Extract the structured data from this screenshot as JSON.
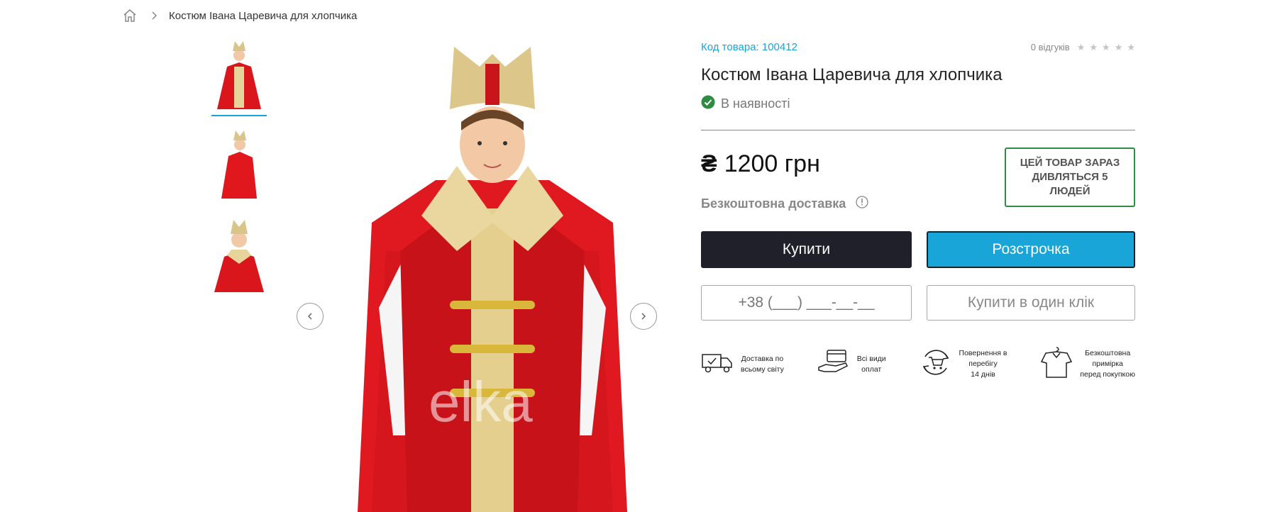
{
  "breadcrumb": {
    "home_icon": "home-icon",
    "current": "Костюм Івана Царевича для хлопчика"
  },
  "gallery": {
    "thumbnails": [
      "thumbnail-front",
      "thumbnail-side",
      "thumbnail-closeup"
    ],
    "watermark": "elka",
    "prev_icon": "chevron-left-icon",
    "next_icon": "chevron-right-icon"
  },
  "product": {
    "code_label": "Код товара: 100412",
    "reviews": "0 відгуків",
    "rating": 0,
    "rating_max": 5,
    "title": "Костюм Івана Царевича для хлопчика",
    "stock": "В наявності",
    "price": "1200 грн",
    "currency_symbol": "₴",
    "delivery": "Безкоштовна доставка",
    "viewers": "ЦЕЙ ТОВАР ЗАРАЗ ДИВЛЯТЬСЯ 5 ЛЮДЕЙ"
  },
  "actions": {
    "buy": "Купити",
    "credit": "Розстрочка",
    "phone_placeholder": "+38 (___) ___-__-__",
    "one_click": "Купити в один клік"
  },
  "features": [
    {
      "icon": "delivery-truck-icon",
      "line1": "Доставка по",
      "line2": "всьому світу",
      "line3": ""
    },
    {
      "icon": "payment-card-icon",
      "line1": "Всі види",
      "line2": "оплат",
      "line3": ""
    },
    {
      "icon": "return-cart-icon",
      "line1": "Повернення в",
      "line2": "перебігу",
      "line3": "14 днів"
    },
    {
      "icon": "fitting-shirt-icon",
      "line1": "Безкоштовна",
      "line2": "примірка",
      "line3": "перед покупкою"
    }
  ],
  "colors": {
    "accent": "#1aa5d9",
    "buy_button": "#1f2029",
    "in_stock": "#2e8b43"
  }
}
